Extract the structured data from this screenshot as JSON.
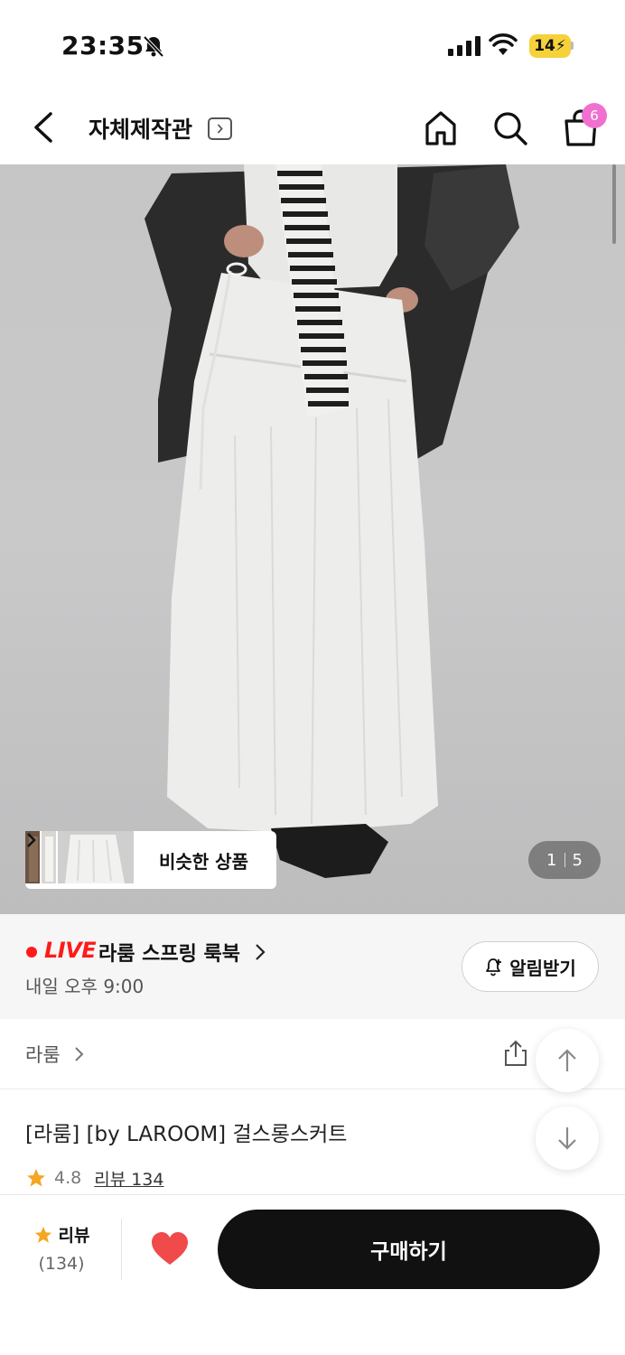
{
  "status_bar": {
    "time": "23:35",
    "battery": "14",
    "icons": [
      "bell-off-icon",
      "signal-icon",
      "wifi-icon",
      "battery-icon"
    ]
  },
  "nav": {
    "title": "자체제작관",
    "icons": [
      "back-icon",
      "chevron-right-icon",
      "home-icon",
      "search-icon",
      "shopping-bag-icon"
    ],
    "cart_count": "6"
  },
  "hero": {
    "similar_label": "비슷한 상품",
    "page_current": "1",
    "page_total": "5"
  },
  "live": {
    "badge": "LIVE",
    "title": "라룸 스프링 룩북",
    "time": "내일 오후 9:00",
    "notify_label": "알림받기",
    "accent_color": "#ff1a1a"
  },
  "brand": {
    "name": "라룸"
  },
  "product": {
    "title": "[라룸] [by LAROOM] 걸스롱스커트",
    "rating": "4.8",
    "review_label": "리뷰 134"
  },
  "bottom_bar": {
    "review_label": "리뷰",
    "review_count": "(134)",
    "buy_label": "구매하기",
    "heart_color": "#f04a4a",
    "star_color": "#f5a623"
  }
}
